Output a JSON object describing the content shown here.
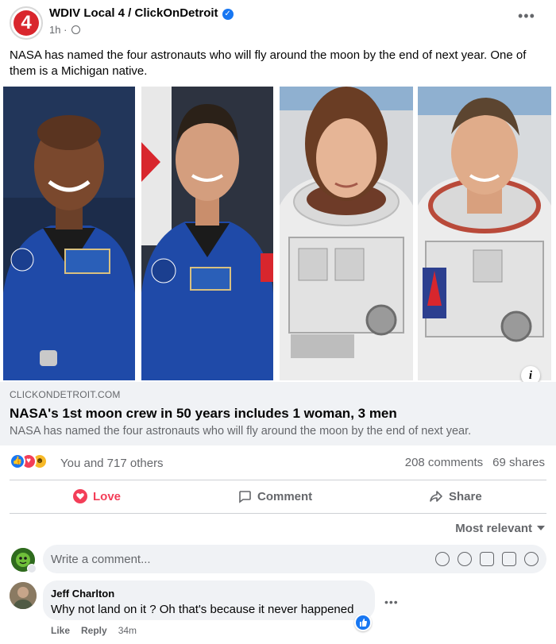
{
  "header": {
    "logo_text": "4",
    "page_name": "WDIV Local 4 / ClickOnDetroit",
    "time": "1h ·",
    "more_label": "•••"
  },
  "post": {
    "text": "NASA has named the four astronauts who will fly around the moon by the end of next year. One of them is a Michigan native."
  },
  "link_preview": {
    "domain": "CLICKONDETROIT.COM",
    "title": "NASA's 1st moon crew in 50 years includes 1 woman, 3 men",
    "description": "NASA has named the four astronauts who will fly around the moon by the end of next year.",
    "info_label": "i"
  },
  "engagement": {
    "reactions_text": "You and 717 others",
    "comments_count": "208 comments",
    "shares_count": "69 shares",
    "reaction_types": [
      "like",
      "love",
      "haha"
    ]
  },
  "actions": {
    "love": "Love",
    "comment": "Comment",
    "share": "Share"
  },
  "comments_section": {
    "sort_label": "Most relevant",
    "input_placeholder": "Write a comment...",
    "input_icons": [
      "sticker-icon",
      "emoji-icon",
      "camera-icon",
      "gif-icon",
      "sticker-smile-icon"
    ]
  },
  "comments": [
    {
      "author": "Jeff Charlton",
      "text": "Why not land on it ? Oh that's because it never happened",
      "like": "Like",
      "reply": "Reply",
      "time": "34m"
    }
  ],
  "colors": {
    "brand_blue": "#1877f2",
    "love_red": "#f33e58",
    "muted_text": "#65676b",
    "link_box_bg": "#f0f2f5"
  }
}
